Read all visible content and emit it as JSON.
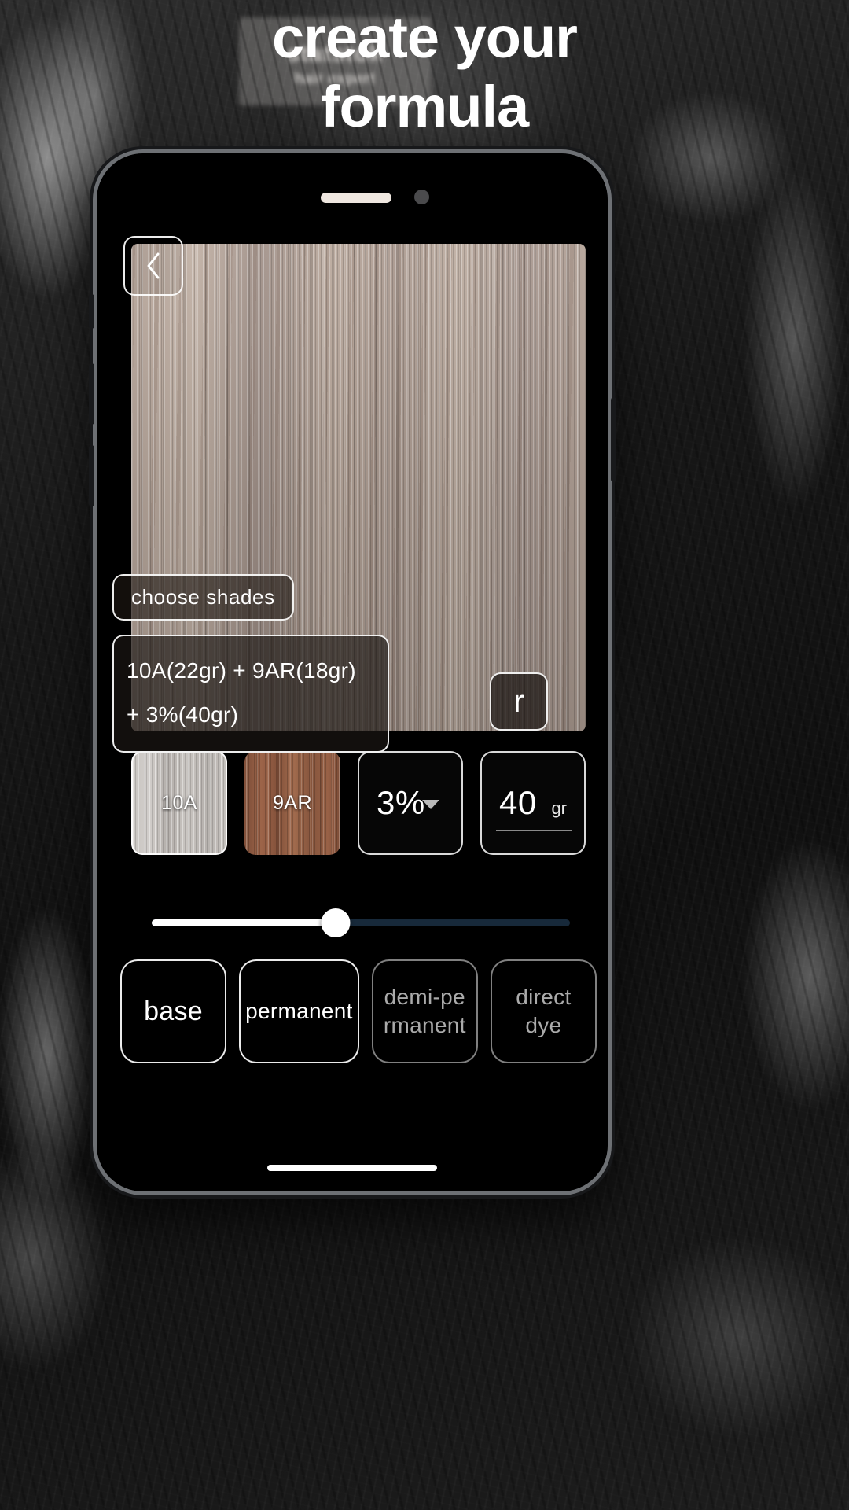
{
  "headline": {
    "line1": "create your",
    "line2": "formula"
  },
  "background": {
    "plaque_line1": "statstok",
    "plaque_line2": "hair expert"
  },
  "phone": {
    "back_icon": "chevron-left-icon",
    "home_indicator": ""
  },
  "preview": {
    "choose_shades_label": "choose  shades",
    "formula_text": "10A(22gr) + 9AR(18gr) + 3%(40gr)",
    "reset_label": "r"
  },
  "shades": {
    "items": [
      {
        "label": "10A",
        "swatch": "silver",
        "color": "#c4c0bc"
      },
      {
        "label": "9AR",
        "swatch": "copper",
        "color": "#8e5b43"
      }
    ]
  },
  "developer": {
    "value": "3%",
    "caret_icon": "chevron-down-icon"
  },
  "dose": {
    "value": "40",
    "unit": "gr"
  },
  "slider": {
    "percent": 44,
    "fill_color": "#ffffff",
    "track_color": "#17293a",
    "thumb_color": "#ffffff"
  },
  "types": [
    {
      "label": "base",
      "state": "active",
      "size": "big"
    },
    {
      "label": "permanent",
      "state": "active",
      "size": "normal"
    },
    {
      "label": "demi-pe rmanent",
      "state": "dim",
      "size": "normal"
    },
    {
      "label": "direct dye",
      "state": "dim",
      "size": "normal"
    }
  ]
}
